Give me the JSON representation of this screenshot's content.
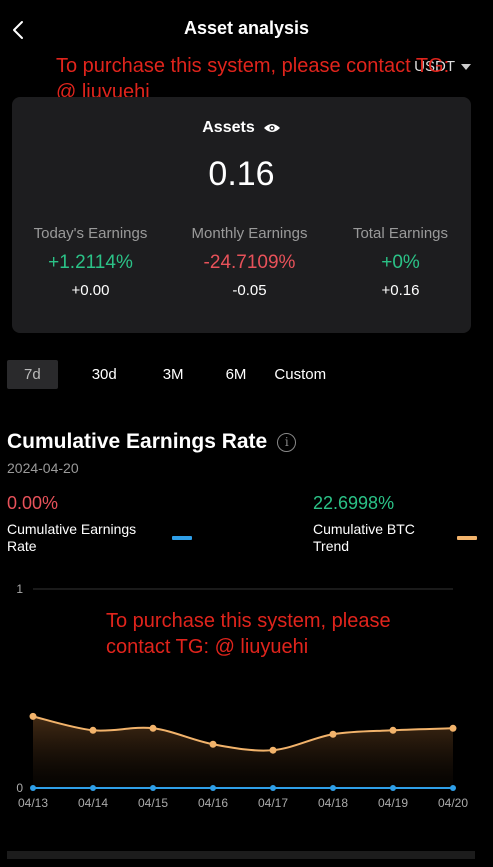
{
  "header": {
    "title": "Asset analysis",
    "currency": "USDT"
  },
  "watermark": {
    "top": "To purchase this system, please contact TG: @ liuyuehi",
    "chart_line1": "To purchase this system, please",
    "chart_line2": "contact TG: @ liuyuehi"
  },
  "assets": {
    "label": "Assets",
    "value": "0.16",
    "metrics": [
      {
        "label": "Today's Earnings",
        "percent": "+1.2114%",
        "amount": "+0.00"
      },
      {
        "label": "Monthly Earnings",
        "percent": "-24.7109%",
        "amount": "-0.05"
      },
      {
        "label": "Total Earnings",
        "percent": "+0%",
        "amount": "+0.16"
      }
    ]
  },
  "tabs": [
    "7d",
    "30d",
    "3M",
    "6M",
    "Custom"
  ],
  "section": {
    "title": "Cumulative Earnings Rate",
    "date": "2024-04-20",
    "left_value": "0.00%",
    "left_label_1": "Cumulative Earnings",
    "left_label_2": "Rate",
    "right_value": "22.6998%",
    "right_label_1": "Cumulative BTC",
    "right_label_2": "Trend"
  },
  "colors": {
    "green": "#2bc287",
    "red": "#e8525a",
    "earnings_line": "#2f9fe8",
    "btc_line": "#f2b36b"
  },
  "chart_data": {
    "type": "line",
    "x": [
      "04/13",
      "04/14",
      "04/15",
      "04/16",
      "04/17",
      "04/18",
      "04/19",
      "04/20"
    ],
    "y_ticks": [
      0,
      1
    ],
    "ylim": [
      0,
      1
    ],
    "series": [
      {
        "name": "Cumulative Earnings Rate",
        "values": [
          0,
          0,
          0,
          0,
          0,
          0,
          0,
          0
        ]
      },
      {
        "name": "Cumulative BTC Trend",
        "values": [
          0.36,
          0.29,
          0.3,
          0.22,
          0.19,
          0.27,
          0.29,
          0.3
        ]
      }
    ]
  }
}
